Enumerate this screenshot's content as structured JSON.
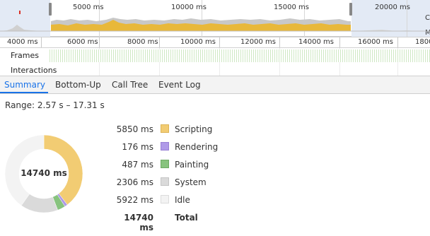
{
  "overview": {
    "tick_labels": [
      "5000 ms",
      "10000 ms",
      "15000 ms",
      "20000 ms"
    ],
    "edge_glyphs": [
      "C",
      "M"
    ]
  },
  "ruler": {
    "tick_labels": [
      "4000 ms",
      "6000 ms",
      "8000 ms",
      "10000 ms",
      "12000 ms",
      "14000 ms",
      "16000 ms",
      "1800"
    ]
  },
  "tracks": {
    "frames": "Frames",
    "interactions": "Interactions"
  },
  "tabs": [
    {
      "label": "Summary",
      "active": true
    },
    {
      "label": "Bottom-Up",
      "active": false
    },
    {
      "label": "Call Tree",
      "active": false
    },
    {
      "label": "Event Log",
      "active": false
    }
  ],
  "summary": {
    "range": "Range: 2.57 s – 17.31 s",
    "donut_center": "14740 ms",
    "categories": [
      {
        "value": "5850 ms",
        "label": "Scripting",
        "ms": 5850,
        "color": "#f2cc73",
        "border": "#dcb457"
      },
      {
        "value": "176 ms",
        "label": "Rendering",
        "ms": 176,
        "color": "#af9ae8",
        "border": "#9880d4"
      },
      {
        "value": "487 ms",
        "label": "Painting",
        "ms": 487,
        "color": "#87c37e",
        "border": "#6caa63"
      },
      {
        "value": "2306 ms",
        "label": "System",
        "ms": 2306,
        "color": "#dadada",
        "border": "#c4c4c4"
      },
      {
        "value": "5922 ms",
        "label": "Idle",
        "ms": 5922,
        "color": "#f3f3f3",
        "border": "#dcdcdc"
      }
    ],
    "total": {
      "value": "14740 ms",
      "label": "Total"
    }
  }
}
